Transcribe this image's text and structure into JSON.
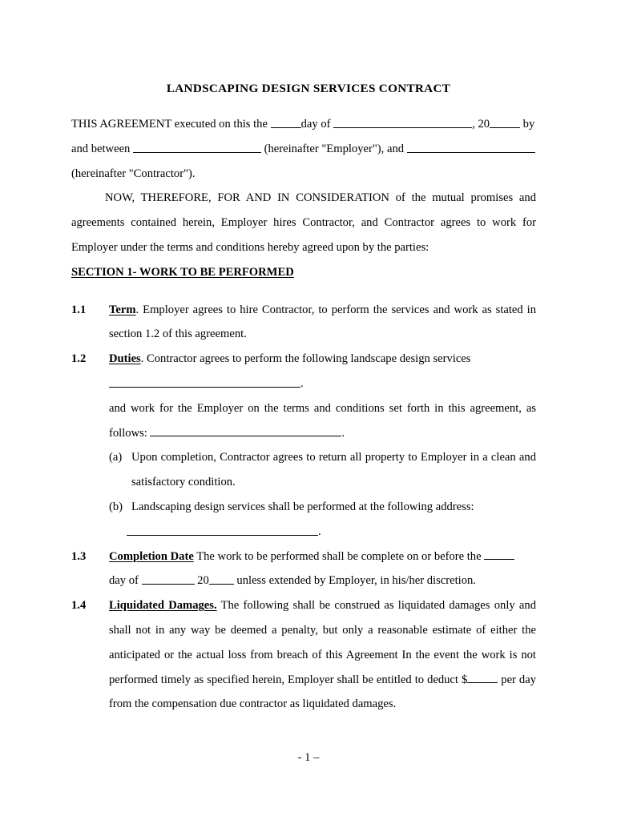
{
  "document": {
    "title": "LANDSCAPING DESIGN SERVICES CONTRACT",
    "footer": "- 1 –"
  },
  "preamble": {
    "line1_a": "THIS AGREEMENT executed on this the ",
    "line1_b": "day of ",
    "line1_c": ", 20",
    "line1_d": " by",
    "line2_a": "and between ",
    "line2_b": " (hereinafter \"Employer\"), and ",
    "line3": "(hereinafter \"Contractor\")."
  },
  "recital": {
    "text": "NOW, THEREFORE, FOR AND IN CONSIDERATION of the mutual promises and agreements contained herein, Employer hires Contractor, and Contractor agrees to work for Employer under the terms and conditions hereby agreed upon by the parties:"
  },
  "section": {
    "heading": "SECTION 1- WORK TO BE PERFORMED"
  },
  "clauses": [
    {
      "number": "1.1",
      "lead": "Term",
      "after_lead": ". ",
      "text": "Employer agrees to hire Contractor, to perform the services and work as stated in section 1.2 of this agreement."
    },
    {
      "number": "1.2",
      "lead": "Duties",
      "after_lead": ". ",
      "text": "Contractor agrees to perform the following landscape design services",
      "blank_tail": ".",
      "continuation": "and work for the Employer on the terms and conditions set forth in this agreement, as follows: ",
      "continuation_tail": "."
    },
    {
      "number": "1.3",
      "lead": "Completion Date",
      "after_lead": " ",
      "text_a": "The work to be performed shall be complete on or before the ",
      "text_b": "day of ",
      "text_c": " 20",
      "text_d": " unless extended by Employer, in his/her discretion."
    },
    {
      "number": "1.4",
      "lead": "Liquidated Damages.",
      "after_lead": "  ",
      "text_a": "The following shall be construed as liquidated damages only and shall not in any way be deemed a penalty, but only a reasonable estimate of either the anticipated or the actual loss from breach of this Agreement   In the event the work is not performed timely as specified herein, Employer shall be entitled to deduct $",
      "text_b": " per day from the compensation due contractor as liquidated damages."
    }
  ],
  "subitems": [
    {
      "label": "(a)",
      "text": "Upon completion, Contractor agrees to return all property to Employer in a clean and satisfactory condition."
    },
    {
      "label": "(b)",
      "text": "Landscaping design services shall be performed at the following address:",
      "blank_tail": "."
    }
  ]
}
